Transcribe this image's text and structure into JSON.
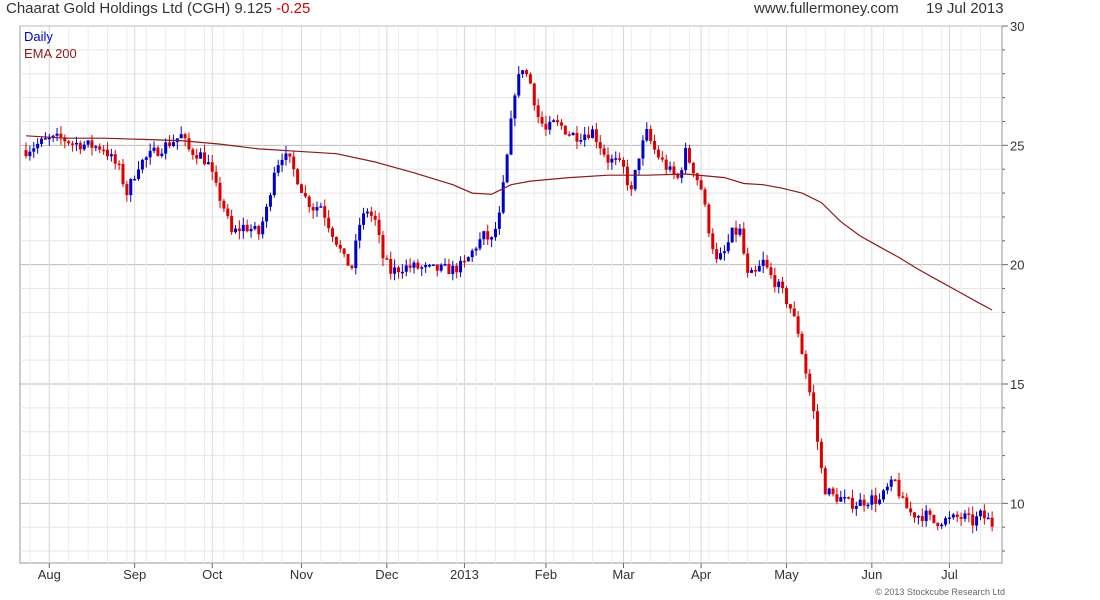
{
  "header": {
    "title": "Chaarat Gold Holdings Ltd (CGH) 9.125",
    "change": "-0.25",
    "site": "www.fullermoney.com",
    "date": "19 Jul 2013"
  },
  "copyright": "© 2013 Stockcube Research Ltd",
  "colors": {
    "up": "#0000cc",
    "down": "#dd0000",
    "ema": "#8b1a1a",
    "grid": "#cccccc",
    "grid_major": "#bbbbbb"
  },
  "chart_data": {
    "type": "line",
    "title": "Chaarat Gold Holdings Ltd (CGH) 9.125 -0.25",
    "legend": [
      "Daily",
      "EMA 200"
    ],
    "legend_position": "top-left",
    "y_axis_side": "right",
    "ylim": [
      7.5,
      30
    ],
    "yticks": [
      10,
      15,
      20,
      25,
      30
    ],
    "grid": true,
    "x_range": [
      0,
      250
    ],
    "x_ticks": [
      {
        "label": "Aug",
        "x": 6
      },
      {
        "label": "Sep",
        "x": 28
      },
      {
        "label": "Oct",
        "x": 48
      },
      {
        "label": "Nov",
        "x": 71
      },
      {
        "label": "Dec",
        "x": 93
      },
      {
        "label": "2013",
        "x": 113
      },
      {
        "label": "Feb",
        "x": 134
      },
      {
        "label": "Mar",
        "x": 154
      },
      {
        "label": "Apr",
        "x": 174
      },
      {
        "label": "May",
        "x": 196
      },
      {
        "label": "Jun",
        "x": 218
      },
      {
        "label": "Jul",
        "x": 238
      }
    ],
    "price_knots": [
      [
        0,
        24.8
      ],
      [
        5,
        25.2
      ],
      [
        9,
        25.3
      ],
      [
        12,
        25.1
      ],
      [
        16,
        25.0
      ],
      [
        20,
        24.9
      ],
      [
        24,
        24.0
      ],
      [
        26,
        23.0
      ],
      [
        29,
        24.2
      ],
      [
        33,
        24.7
      ],
      [
        37,
        25.1
      ],
      [
        40,
        25.4
      ],
      [
        42,
        24.8
      ],
      [
        45,
        24.6
      ],
      [
        47,
        24.2
      ],
      [
        49,
        23.2
      ],
      [
        51,
        22.4
      ],
      [
        53,
        21.3
      ],
      [
        56,
        21.6
      ],
      [
        58,
        21.5
      ],
      [
        60,
        21.3
      ],
      [
        62,
        22.3
      ],
      [
        64,
        24.0
      ],
      [
        66,
        24.6
      ],
      [
        68,
        24.3
      ],
      [
        70,
        23.6
      ],
      [
        72,
        22.8
      ],
      [
        74,
        22.4
      ],
      [
        76,
        22.5
      ],
      [
        78,
        21.7
      ],
      [
        80,
        21.0
      ],
      [
        82,
        20.2
      ],
      [
        84,
        19.9
      ],
      [
        86,
        21.7
      ],
      [
        88,
        22.3
      ],
      [
        90,
        21.8
      ],
      [
        92,
        20.3
      ],
      [
        94,
        19.7
      ],
      [
        97,
        19.9
      ],
      [
        100,
        19.9
      ],
      [
        104,
        19.8
      ],
      [
        106,
        19.8
      ],
      [
        110,
        19.8
      ],
      [
        113,
        20.0
      ],
      [
        116,
        20.8
      ],
      [
        118,
        21.2
      ],
      [
        120,
        21.0
      ],
      [
        122,
        22.0
      ],
      [
        124,
        24.5
      ],
      [
        126,
        27.3
      ],
      [
        128,
        28.3
      ],
      [
        130,
        27.6
      ],
      [
        132,
        26.2
      ],
      [
        134,
        25.6
      ],
      [
        136,
        25.9
      ],
      [
        138,
        25.8
      ],
      [
        140,
        25.5
      ],
      [
        142,
        25.4
      ],
      [
        144,
        25.5
      ],
      [
        146,
        25.6
      ],
      [
        148,
        25.0
      ],
      [
        150,
        24.4
      ],
      [
        152,
        24.3
      ],
      [
        154,
        24.0
      ],
      [
        156,
        23.0
      ],
      [
        158,
        24.6
      ],
      [
        160,
        25.5
      ],
      [
        162,
        24.8
      ],
      [
        164,
        24.3
      ],
      [
        166,
        23.9
      ],
      [
        168,
        23.6
      ],
      [
        170,
        24.7
      ],
      [
        172,
        24.0
      ],
      [
        174,
        23.2
      ],
      [
        176,
        21.5
      ],
      [
        178,
        20.1
      ],
      [
        180,
        20.5
      ],
      [
        182,
        21.3
      ],
      [
        184,
        21.4
      ],
      [
        186,
        19.5
      ],
      [
        188,
        19.6
      ],
      [
        190,
        20.1
      ],
      [
        192,
        19.5
      ],
      [
        193,
        19.3
      ],
      [
        195,
        18.8
      ],
      [
        197,
        18.2
      ],
      [
        199,
        17.2
      ],
      [
        201,
        15.5
      ],
      [
        203,
        13.8
      ],
      [
        205,
        11.4
      ],
      [
        206,
        10.6
      ],
      [
        208,
        10.3
      ],
      [
        210,
        10.2
      ],
      [
        212,
        10.0
      ],
      [
        214,
        10.0
      ],
      [
        216,
        10.1
      ],
      [
        218,
        10.2
      ],
      [
        220,
        10.1
      ],
      [
        222,
        10.6
      ],
      [
        224,
        10.9
      ],
      [
        226,
        10.0
      ],
      [
        228,
        9.6
      ],
      [
        230,
        9.5
      ],
      [
        232,
        9.5
      ],
      [
        234,
        9.2
      ],
      [
        236,
        9.3
      ],
      [
        238,
        9.3
      ],
      [
        240,
        9.4
      ],
      [
        242,
        9.4
      ],
      [
        244,
        9.2
      ],
      [
        246,
        9.5
      ],
      [
        248,
        9.3
      ],
      [
        249,
        9.125
      ]
    ],
    "ema_200": [
      [
        0,
        25.4
      ],
      [
        10,
        25.3
      ],
      [
        20,
        25.3
      ],
      [
        30,
        25.25
      ],
      [
        40,
        25.2
      ],
      [
        50,
        25.05
      ],
      [
        60,
        24.85
      ],
      [
        70,
        24.75
      ],
      [
        80,
        24.65
      ],
      [
        90,
        24.3
      ],
      [
        100,
        23.85
      ],
      [
        110,
        23.35
      ],
      [
        115,
        23.0
      ],
      [
        120,
        22.95
      ],
      [
        125,
        23.35
      ],
      [
        130,
        23.5
      ],
      [
        140,
        23.65
      ],
      [
        150,
        23.75
      ],
      [
        160,
        23.75
      ],
      [
        170,
        23.8
      ],
      [
        180,
        23.65
      ],
      [
        185,
        23.4
      ],
      [
        190,
        23.35
      ],
      [
        195,
        23.2
      ],
      [
        200,
        23.0
      ],
      [
        205,
        22.6
      ],
      [
        210,
        21.8
      ],
      [
        215,
        21.2
      ],
      [
        220,
        20.75
      ],
      [
        225,
        20.3
      ],
      [
        230,
        19.8
      ],
      [
        235,
        19.35
      ],
      [
        240,
        18.9
      ],
      [
        245,
        18.45
      ],
      [
        249,
        18.1
      ]
    ]
  }
}
